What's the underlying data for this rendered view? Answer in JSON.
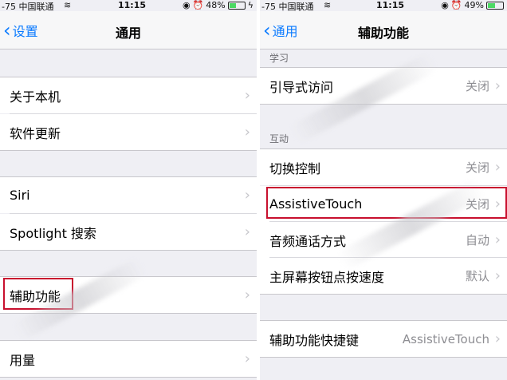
{
  "left": {
    "status": {
      "carrier": "-75 中国联通",
      "time": "11:15",
      "battery": "48%",
      "battery_level": 0.48
    },
    "nav": {
      "back_label": "设置",
      "title": "通用"
    },
    "rows": [
      {
        "label": "关于本机"
      },
      {
        "label": "软件更新"
      },
      {
        "label": "Siri"
      },
      {
        "label": "Spotlight 搜索"
      },
      {
        "label": "辅助功能"
      },
      {
        "label": "用量"
      }
    ]
  },
  "right": {
    "status": {
      "carrier": "-75 中国联通",
      "time": "11:15",
      "battery": "49%",
      "battery_level": 0.49
    },
    "nav": {
      "back_label": "通用",
      "title": "辅助功能"
    },
    "sections": {
      "learning": "学习",
      "interaction": "互动"
    },
    "rows": [
      {
        "label": "引导式访问",
        "value": "关闭"
      },
      {
        "label": "切换控制",
        "value": "关闭"
      },
      {
        "label": "AssistiveTouch",
        "value": "关闭"
      },
      {
        "label": "音频通话方式",
        "value": "自动"
      },
      {
        "label": "主屏幕按钮点按速度",
        "value": "默认"
      },
      {
        "label": "辅助功能快捷键",
        "value": "AssistiveTouch"
      }
    ]
  },
  "icons": {
    "chevron_right": "›",
    "chevron_left": "‹",
    "wifi": "≋",
    "lock": "◉",
    "alarm": "⏰",
    "charging": "ϟ"
  },
  "colors": {
    "accent": "#0a7aff",
    "highlight": "#c8102e",
    "battery": "#4cd964",
    "secondary_text": "#8e8e93"
  }
}
